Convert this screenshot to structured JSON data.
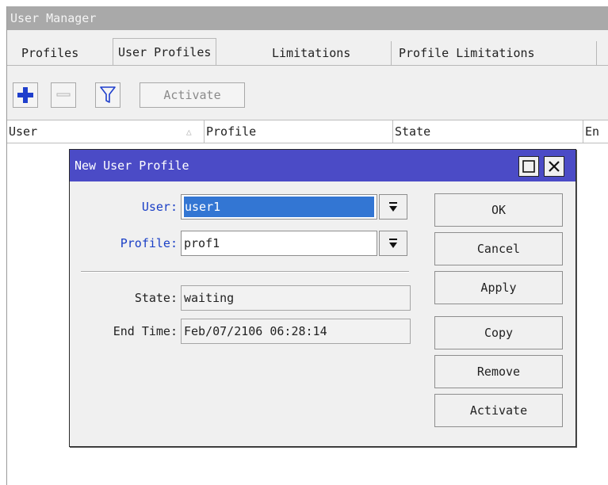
{
  "window": {
    "title": "User Manager"
  },
  "tabs": [
    {
      "label": "Profiles"
    },
    {
      "label": "User Profiles"
    },
    {
      "label": "Limitations"
    },
    {
      "label": "Profile Limitations"
    }
  ],
  "active_tab": "User Profiles",
  "toolbar": {
    "add_icon": "plus-icon",
    "remove_icon": "minus-icon",
    "filter_icon": "filter-icon",
    "activate_label": "Activate"
  },
  "table": {
    "columns": [
      {
        "label": "User"
      },
      {
        "label": "Profile"
      },
      {
        "label": "State"
      },
      {
        "label": "En"
      }
    ],
    "sorted_by": "User",
    "sort_direction": "ascending",
    "rows": []
  },
  "dialog": {
    "title": "New User Profile",
    "fields": {
      "user": {
        "label": "User:",
        "value": "user1"
      },
      "profile": {
        "label": "Profile:",
        "value": "prof1"
      },
      "state": {
        "label": "State:",
        "value": "waiting"
      },
      "end_time": {
        "label": "End Time:",
        "value": "Feb/07/2106 06:28:14"
      }
    },
    "buttons": {
      "ok": "OK",
      "cancel": "Cancel",
      "apply": "Apply",
      "copy": "Copy",
      "remove": "Remove",
      "activate": "Activate"
    }
  },
  "colors": {
    "titlebar": "#a9a9a9",
    "dialog_title": "#4b4bc6",
    "field_label_blue": "#1a3fc6",
    "selection": "#3376d3",
    "add_icon": "#1f3fcc"
  }
}
